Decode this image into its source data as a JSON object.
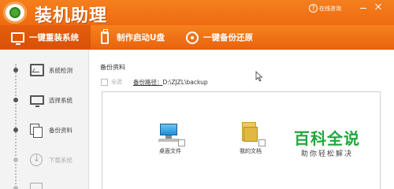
{
  "titlebar": {
    "app_title": "装机助理",
    "online_help": "在线咨询"
  },
  "tabs": [
    {
      "label": "一键重装系统",
      "icon": "monitor-icon",
      "active": true
    },
    {
      "label": "制作启动U盘",
      "icon": "usb-drive-icon",
      "active": false
    },
    {
      "label": "一键备份还原",
      "icon": "restore-icon",
      "active": false
    }
  ],
  "sidebar": {
    "steps": [
      {
        "label": "系统检测",
        "icon": "system-detect-icon",
        "enabled": true
      },
      {
        "label": "选择系统",
        "icon": "select-system-icon",
        "enabled": true
      },
      {
        "label": "备份资料",
        "icon": "backup-data-icon",
        "enabled": true
      },
      {
        "label": "下载系统",
        "icon": "download-icon",
        "enabled": false
      },
      {
        "label": "",
        "icon": "install-icon",
        "enabled": false
      }
    ]
  },
  "main": {
    "section_title": "备份资料",
    "select_all": "全选",
    "backup_path_label": "备份路径：",
    "backup_path_value": "D:\\ZJZL\\backup",
    "files": [
      {
        "label": "桌面文件",
        "icon": "desktop-icon"
      },
      {
        "label": "我的文档",
        "icon": "documents-folder-icon"
      }
    ]
  },
  "watermark": {
    "title": "百科全说",
    "subtitle": "助你轻松解决"
  },
  "colors": {
    "accent": "#f07018",
    "watermark_green": "#1fa83a"
  }
}
